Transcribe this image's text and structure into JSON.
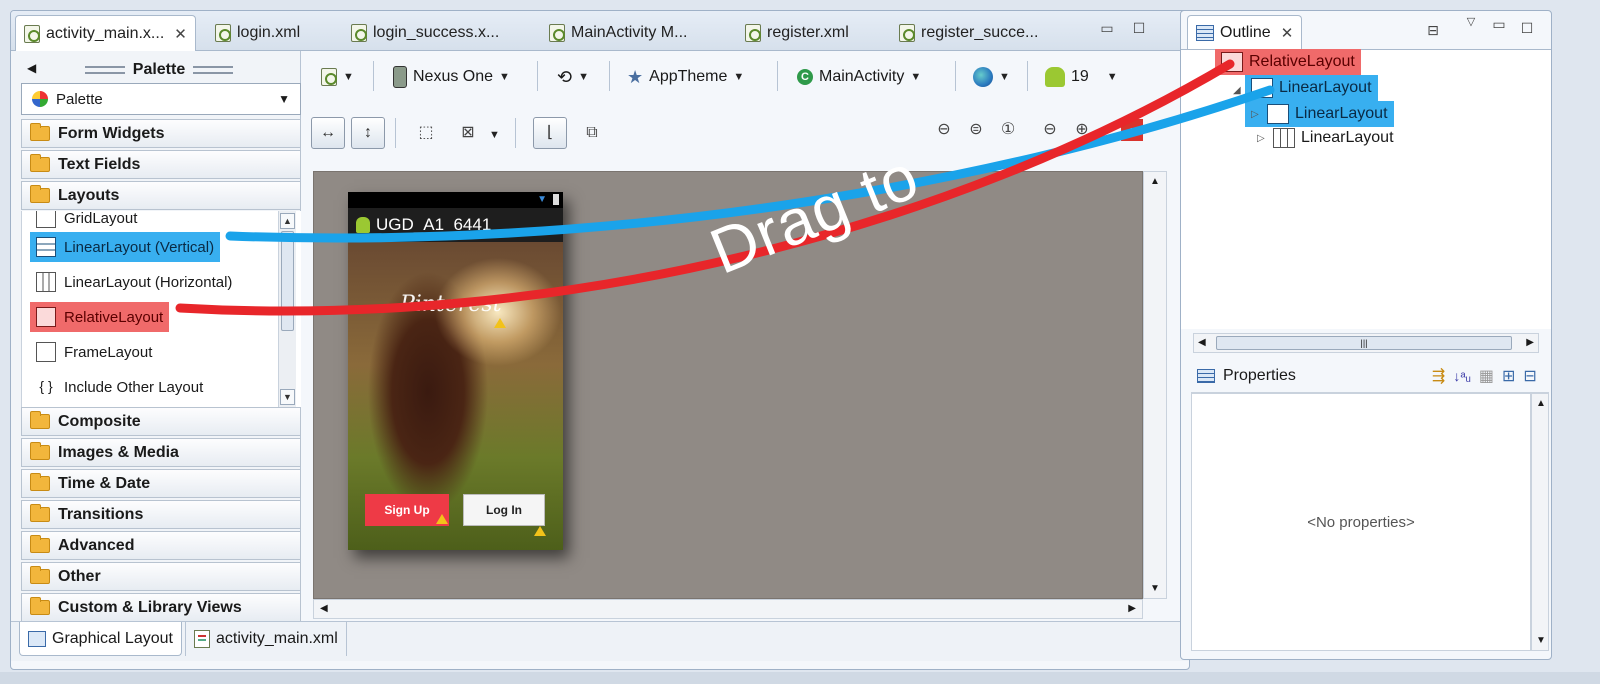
{
  "editor_tabs": [
    {
      "label": "activity_main.x...",
      "active": true
    },
    {
      "label": "login.xml"
    },
    {
      "label": "login_success.x..."
    },
    {
      "label": "MainActivity M..."
    },
    {
      "label": "register.xml"
    },
    {
      "label": "register_succe..."
    }
  ],
  "palette": {
    "title": "Palette",
    "selector": "Palette",
    "categories_top": [
      "Form Widgets",
      "Text Fields",
      "Layouts"
    ],
    "layout_items": [
      "GridLayout",
      "LinearLayout (Vertical)",
      "LinearLayout (Horizontal)",
      "RelativeLayout",
      "FrameLayout",
      "Include Other Layout"
    ],
    "categories_bottom": [
      "Composite",
      "Images & Media",
      "Time & Date",
      "Transitions",
      "Advanced",
      "Other",
      "Custom & Library Views"
    ]
  },
  "toolbar": {
    "device": "Nexus One",
    "theme": "AppTheme",
    "activity": "MainActivity",
    "api_level": "19"
  },
  "phone": {
    "app_title": "UGD_A1_6441",
    "logo_text": "Pinterest",
    "signup_label": "Sign Up",
    "login_label": "Log In"
  },
  "bottom_tabs": [
    "Graphical Layout",
    "activity_main.xml"
  ],
  "outline": {
    "tab_label": "Outline",
    "tree": [
      "RelativeLayout",
      "LinearLayout",
      "LinearLayout",
      "LinearLayout"
    ]
  },
  "properties": {
    "title": "Properties",
    "empty_text": "<No properties>"
  },
  "annotation": {
    "text": "Drag to",
    "colors": {
      "blue": "#1aa3ea",
      "red": "#e8262a"
    }
  }
}
